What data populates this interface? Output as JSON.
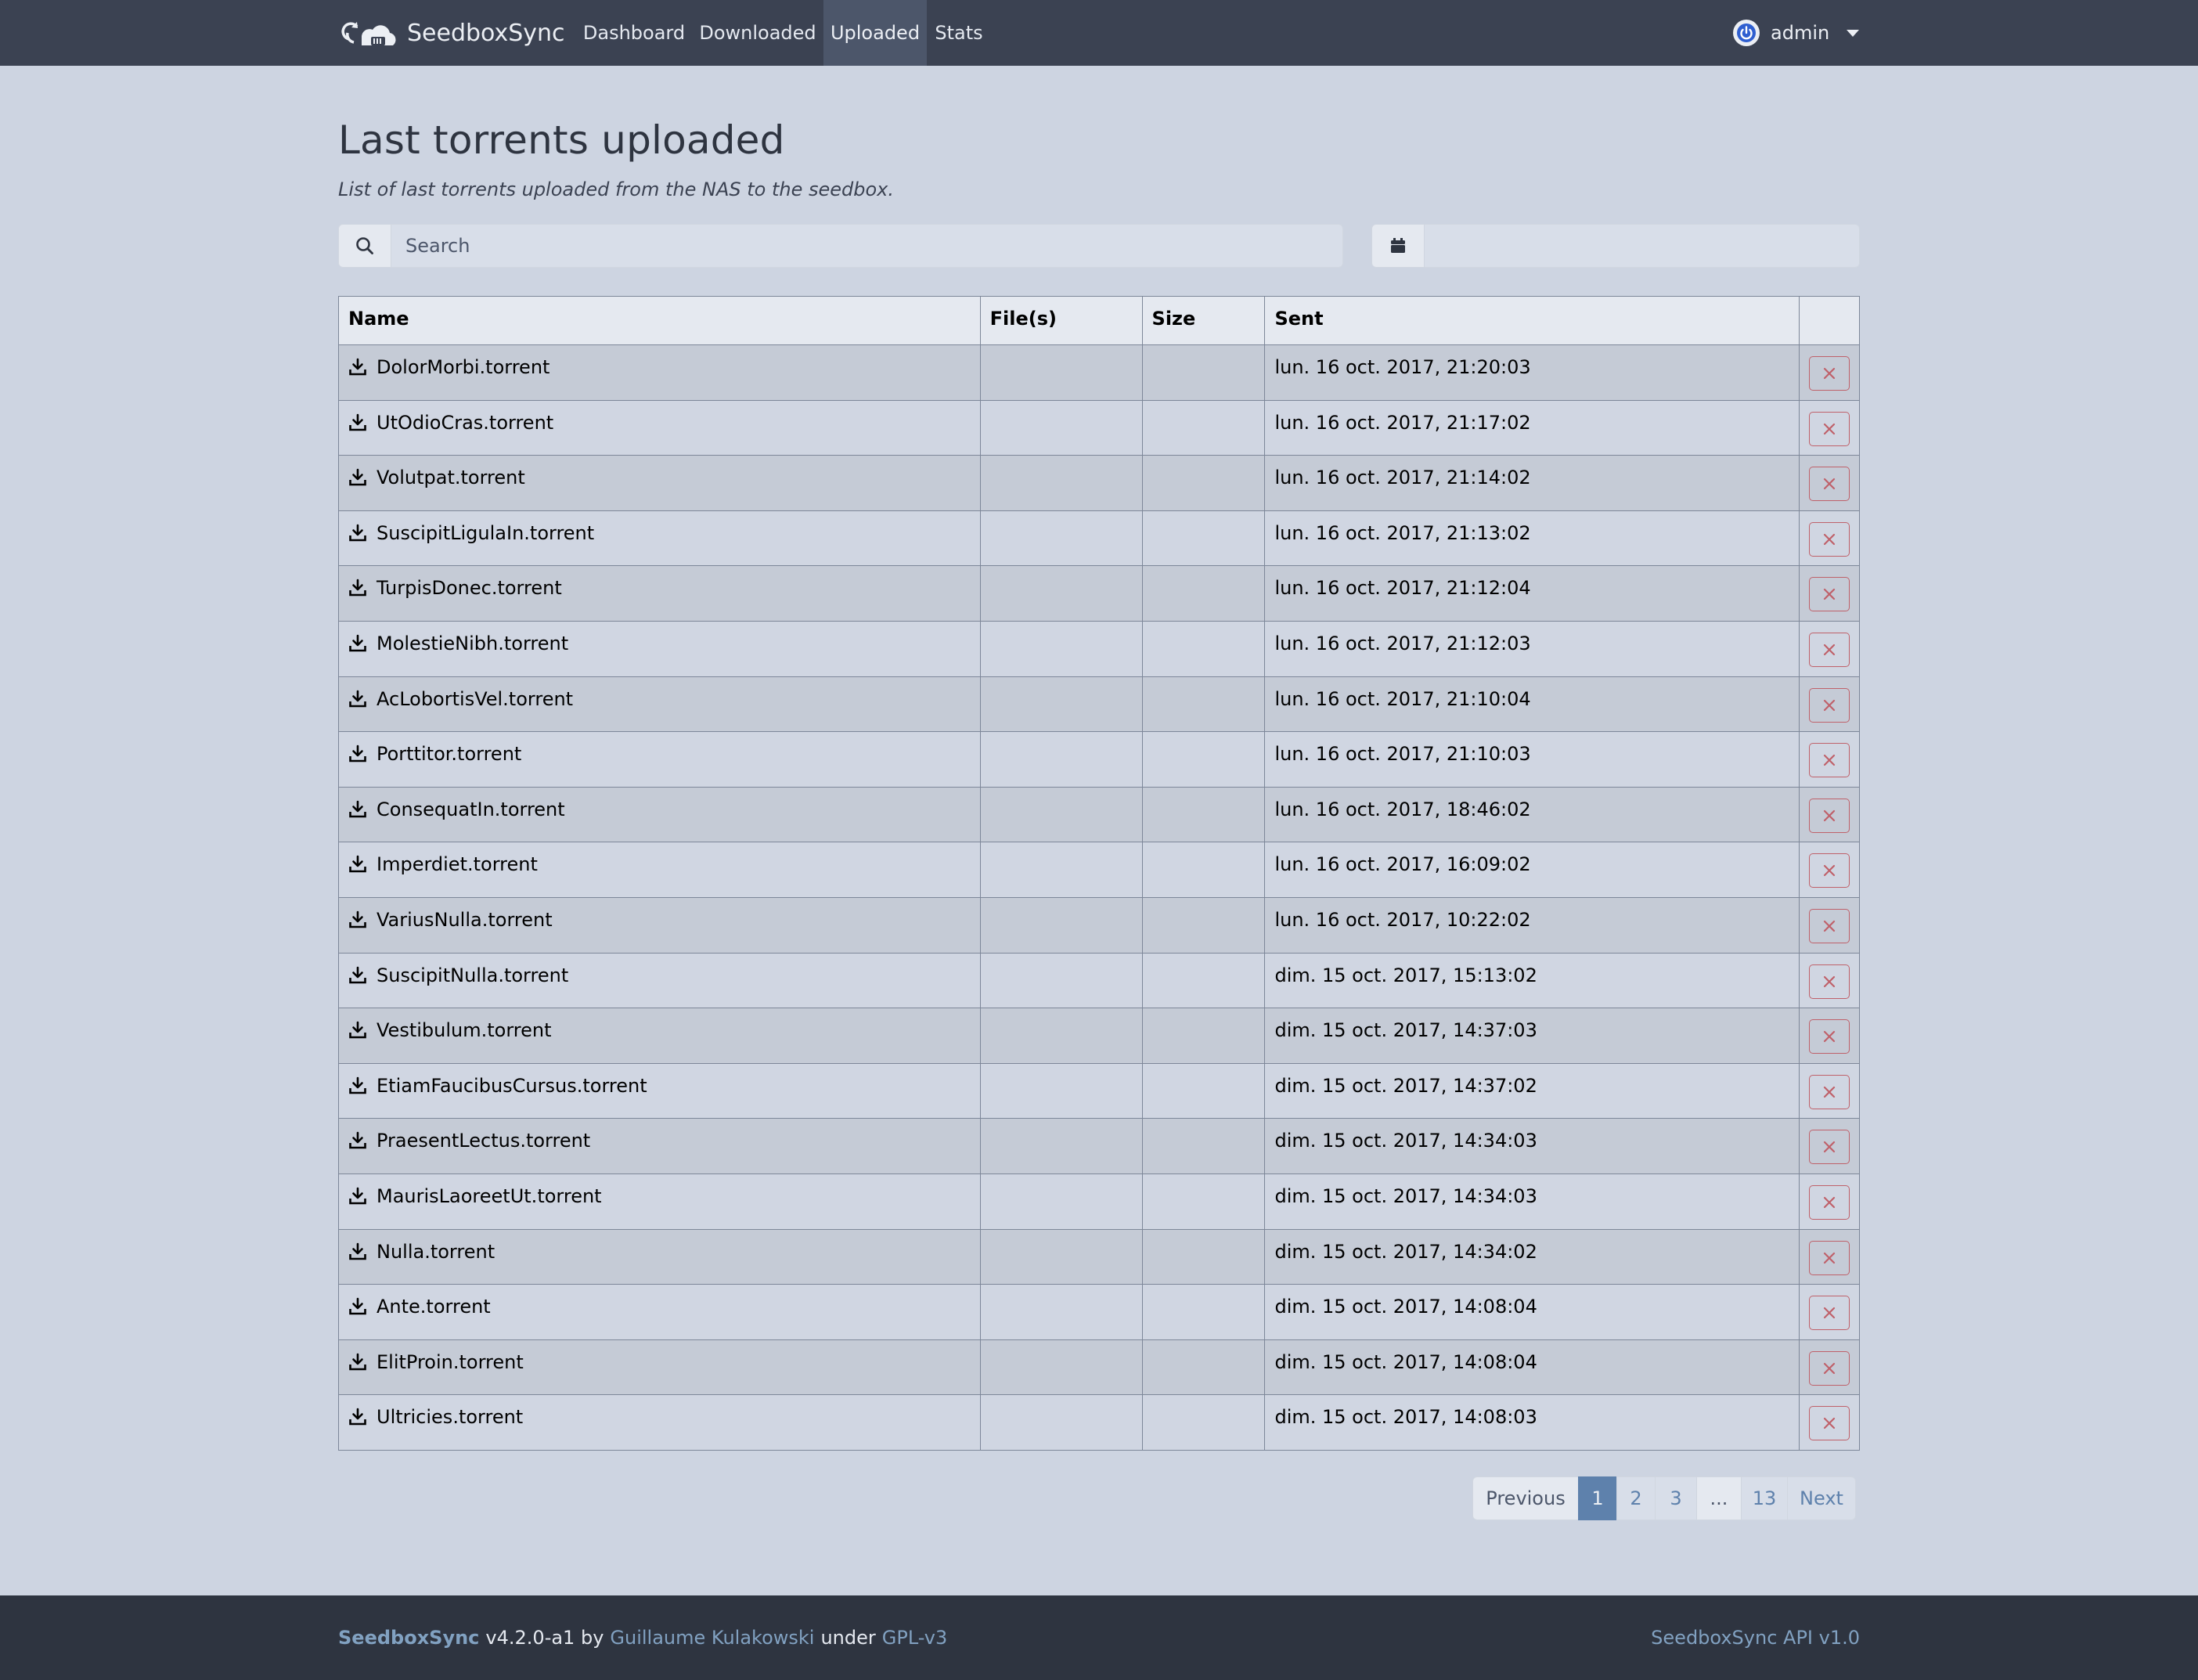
{
  "app": {
    "brand": "SeedboxSync",
    "nav": [
      {
        "label": "Dashboard",
        "active": false
      },
      {
        "label": "Downloaded",
        "active": false
      },
      {
        "label": "Uploaded",
        "active": true
      },
      {
        "label": "Stats",
        "active": false
      }
    ],
    "user": "admin"
  },
  "page": {
    "title": "Last torrents uploaded",
    "subtitle": "List of last torrents uploaded from the NAS to the seedbox.",
    "search_placeholder": "Search",
    "date_value": ""
  },
  "table": {
    "headers": {
      "name": "Name",
      "files": "File(s)",
      "size": "Size",
      "sent": "Sent",
      "actions": ""
    },
    "rows": [
      {
        "name": "DolorMorbi.torrent",
        "files": "",
        "size": "",
        "sent": "lun. 16 oct. 2017, 21:20:03"
      },
      {
        "name": "UtOdioCras.torrent",
        "files": "",
        "size": "",
        "sent": "lun. 16 oct. 2017, 21:17:02"
      },
      {
        "name": "Volutpat.torrent",
        "files": "",
        "size": "",
        "sent": "lun. 16 oct. 2017, 21:14:02"
      },
      {
        "name": "SuscipitLigulaIn.torrent",
        "files": "",
        "size": "",
        "sent": "lun. 16 oct. 2017, 21:13:02"
      },
      {
        "name": "TurpisDonec.torrent",
        "files": "",
        "size": "",
        "sent": "lun. 16 oct. 2017, 21:12:04"
      },
      {
        "name": "MolestieNibh.torrent",
        "files": "",
        "size": "",
        "sent": "lun. 16 oct. 2017, 21:12:03"
      },
      {
        "name": "AcLobortisVel.torrent",
        "files": "",
        "size": "",
        "sent": "lun. 16 oct. 2017, 21:10:04"
      },
      {
        "name": "Porttitor.torrent",
        "files": "",
        "size": "",
        "sent": "lun. 16 oct. 2017, 21:10:03"
      },
      {
        "name": "ConsequatIn.torrent",
        "files": "",
        "size": "",
        "sent": "lun. 16 oct. 2017, 18:46:02"
      },
      {
        "name": "Imperdiet.torrent",
        "files": "",
        "size": "",
        "sent": "lun. 16 oct. 2017, 16:09:02"
      },
      {
        "name": "VariusNulla.torrent",
        "files": "",
        "size": "",
        "sent": "lun. 16 oct. 2017, 10:22:02"
      },
      {
        "name": "SuscipitNulla.torrent",
        "files": "",
        "size": "",
        "sent": "dim. 15 oct. 2017, 15:13:02"
      },
      {
        "name": "Vestibulum.torrent",
        "files": "",
        "size": "",
        "sent": "dim. 15 oct. 2017, 14:37:03"
      },
      {
        "name": "EtiamFaucibusCursus.torrent",
        "files": "",
        "size": "",
        "sent": "dim. 15 oct. 2017, 14:37:02"
      },
      {
        "name": "PraesentLectus.torrent",
        "files": "",
        "size": "",
        "sent": "dim. 15 oct. 2017, 14:34:03"
      },
      {
        "name": "MaurisLaoreetUt.torrent",
        "files": "",
        "size": "",
        "sent": "dim. 15 oct. 2017, 14:34:03"
      },
      {
        "name": "Nulla.torrent",
        "files": "",
        "size": "",
        "sent": "dim. 15 oct. 2017, 14:34:02"
      },
      {
        "name": "Ante.torrent",
        "files": "",
        "size": "",
        "sent": "dim. 15 oct. 2017, 14:08:04"
      },
      {
        "name": "ElitProin.torrent",
        "files": "",
        "size": "",
        "sent": "dim. 15 oct. 2017, 14:08:04"
      },
      {
        "name": "Ultricies.torrent",
        "files": "",
        "size": "",
        "sent": "dim. 15 oct. 2017, 14:08:03"
      }
    ]
  },
  "pagination": {
    "previous": "Previous",
    "pages": [
      "1",
      "2",
      "3",
      "...",
      "13"
    ],
    "current": "1",
    "next": "Next"
  },
  "footer": {
    "app_name": "SeedboxSync",
    "version_by": "v4.2.0-a1 by",
    "author": "Guillaume Kulakowski",
    "under": "under",
    "license": "GPL-v3",
    "api": "SeedboxSync API v1.0"
  },
  "icons": {
    "search": "search-icon",
    "calendar": "calendar-icon",
    "download": "download-icon",
    "delete": "close-icon",
    "power": "power-icon",
    "caret": "chevron-down-icon"
  },
  "colors": {
    "navbar": "#3b4252",
    "background": "#cdd4e1",
    "accent": "#5e81ac",
    "danger": "#bf616a",
    "footer": "#2e3440"
  }
}
